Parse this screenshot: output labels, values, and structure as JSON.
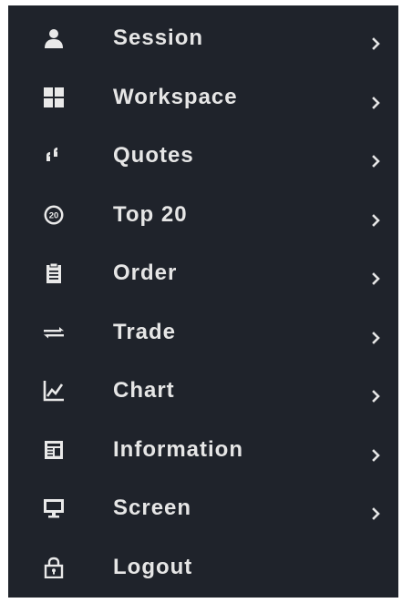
{
  "menu": {
    "items": [
      {
        "label": "Session",
        "icon": "user-icon",
        "has_submenu": true
      },
      {
        "label": "Workspace",
        "icon": "grid-icon",
        "has_submenu": true
      },
      {
        "label": "Quotes",
        "icon": "quotes-icon",
        "has_submenu": true
      },
      {
        "label": "Top 20",
        "icon": "top20-badge-icon",
        "has_submenu": true
      },
      {
        "label": "Order",
        "icon": "clipboard-icon",
        "has_submenu": true
      },
      {
        "label": "Trade",
        "icon": "exchange-arrows-icon",
        "has_submenu": true
      },
      {
        "label": "Chart",
        "icon": "line-chart-icon",
        "has_submenu": true
      },
      {
        "label": "Information",
        "icon": "newspaper-icon",
        "has_submenu": true
      },
      {
        "label": "Screen",
        "icon": "monitor-icon",
        "has_submenu": true
      },
      {
        "label": "Logout",
        "icon": "lock-icon",
        "has_submenu": false
      }
    ],
    "top20_badge_text": "20"
  },
  "colors": {
    "background": "#1f232b",
    "text": "#e6e6e6",
    "page": "#ffffff"
  }
}
